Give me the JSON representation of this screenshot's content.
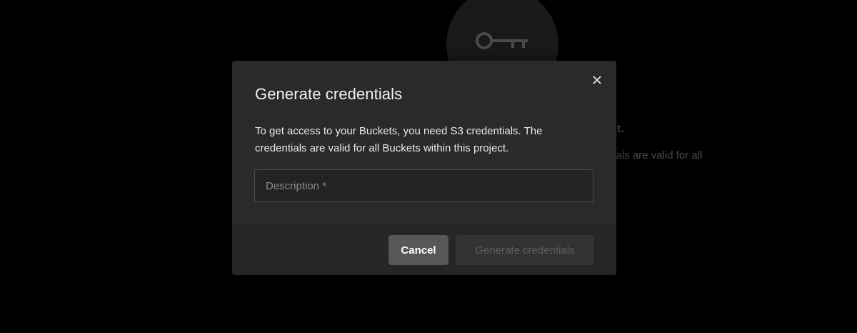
{
  "background": {
    "icon": "key-icon",
    "heading_fragment": "et.",
    "text_fragment": "tials are valid for all"
  },
  "dialog": {
    "title": "Generate credentials",
    "close_icon": "close-icon",
    "description": "To get access to your Buckets, you need S3 credentials. The credentials are valid for all Buckets within this project.",
    "input": {
      "placeholder": "Description *",
      "value": ""
    },
    "buttons": {
      "cancel": "Cancel",
      "generate": "Generate credentials"
    }
  },
  "colors": {
    "backdrop": "#000000",
    "dialog_bg": "#2a2a2a",
    "footer_bg": "#262626",
    "cancel_bg": "#575757",
    "generate_disabled_bg": "#333333",
    "generate_disabled_text": "#5e5e5e"
  }
}
